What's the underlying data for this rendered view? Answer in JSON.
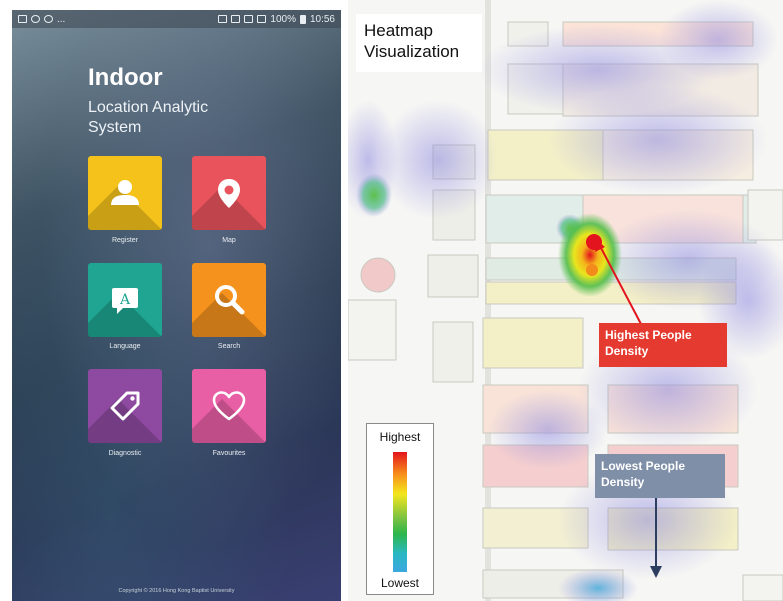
{
  "phone": {
    "status_bar": {
      "dots": "...",
      "battery": "100%",
      "time": "10:56"
    },
    "app_title": "Indoor",
    "app_subtitle": "Location Analytic System",
    "tiles": [
      {
        "label": "Register",
        "icon": "user-icon",
        "color": "#f4c21a"
      },
      {
        "label": "Map",
        "icon": "map-pin-icon",
        "color": "#e9545c"
      },
      {
        "label": "Language",
        "icon": "language-icon",
        "color": "#1fa591"
      },
      {
        "label": "Search",
        "icon": "search-icon",
        "color": "#f5921e"
      },
      {
        "label": "Diagnostic",
        "icon": "tag-icon",
        "color": "#8e4aa0"
      },
      {
        "label": "Favourites",
        "icon": "heart-icon",
        "color": "#e85fa6"
      }
    ],
    "copyright": "Copyright © 2016 Hong Kong Baptist University"
  },
  "heatmap": {
    "title": "Heatmap Visualization",
    "highest_callout": "Highest People Density",
    "lowest_callout": "Lowest People Density",
    "legend": {
      "high": "Highest",
      "low": "Lowest"
    },
    "colors": {
      "highest": "#e3141d",
      "lowest": "#3ba7e0",
      "low_density": "#8f8be0"
    }
  }
}
